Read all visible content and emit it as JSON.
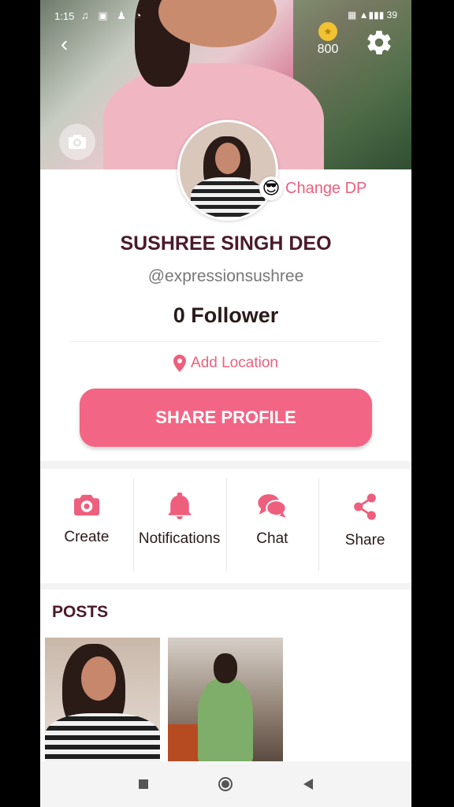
{
  "status_bar": {
    "time": "1:15",
    "app_icons": "♫ ▣ ♟ ◔",
    "right": "▦ ▲▮▮▮ 39"
  },
  "header": {
    "coins": "800",
    "coin_symbol": "★"
  },
  "profile": {
    "change_dp_emoji": "😎",
    "change_dp_label": "Change DP",
    "name": "SUSHREE SINGH DEO",
    "handle": "@expressionsushree",
    "followers": "0 Follower",
    "location_label": "Add Location",
    "share_label": "SHARE PROFILE"
  },
  "actions": [
    {
      "label": "Create",
      "icon": "camera-icon"
    },
    {
      "label": "Notifications",
      "icon": "bell-icon"
    },
    {
      "label": "Chat",
      "icon": "chat-icon"
    },
    {
      "label": "Share",
      "icon": "share-icon"
    }
  ],
  "posts": {
    "title": "POSTS",
    "count": 2
  },
  "colors": {
    "accent": "#f36584",
    "accent_text": "#ee5f7d",
    "name": "#4b1a2c"
  }
}
